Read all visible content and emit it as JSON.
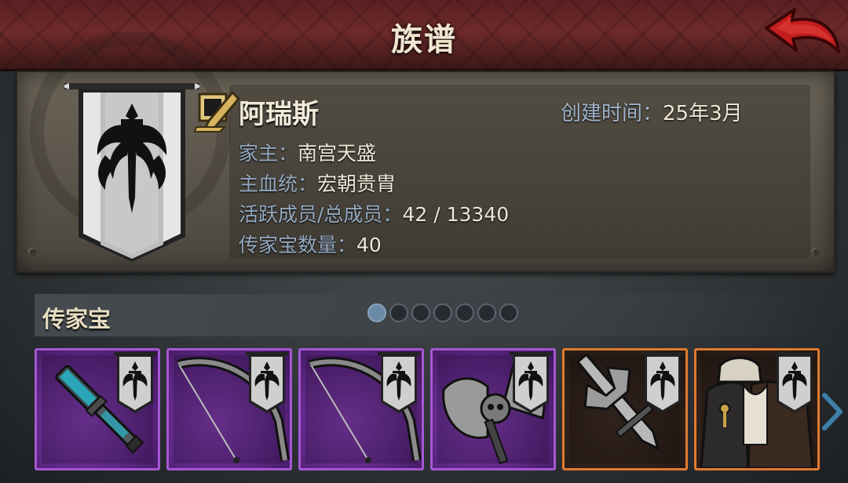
{
  "header": {
    "title": "族谱",
    "back_icon": "back-arrow-icon"
  },
  "clan": {
    "name": "阿瑞斯",
    "created_label": "创建时间：",
    "created_value": "25年3月",
    "rows": [
      {
        "label": "家主：",
        "value": "南宫天盛"
      },
      {
        "label": "主血统：",
        "value": "宏朝贵胄"
      },
      {
        "label": "活跃成员/总成员：",
        "value": "42 / 13340"
      },
      {
        "label": "传家宝数量：",
        "value": "40"
      }
    ]
  },
  "heirlooms": {
    "title": "传家宝",
    "pages": 7,
    "current_page": 1,
    "items": [
      {
        "rarity": "purple",
        "icon": "mace-icon"
      },
      {
        "rarity": "purple",
        "icon": "bow-icon"
      },
      {
        "rarity": "purple",
        "icon": "bow-icon"
      },
      {
        "rarity": "purple",
        "icon": "skull-axe-icon"
      },
      {
        "rarity": "orange",
        "icon": "sword-icon"
      },
      {
        "rarity": "orange",
        "icon": "armor-icon"
      }
    ]
  },
  "colors": {
    "header": "#6e2a2a",
    "purple_rarity": "#a458d4",
    "orange_rarity": "#e07a2e",
    "label": "#93a9c0"
  }
}
